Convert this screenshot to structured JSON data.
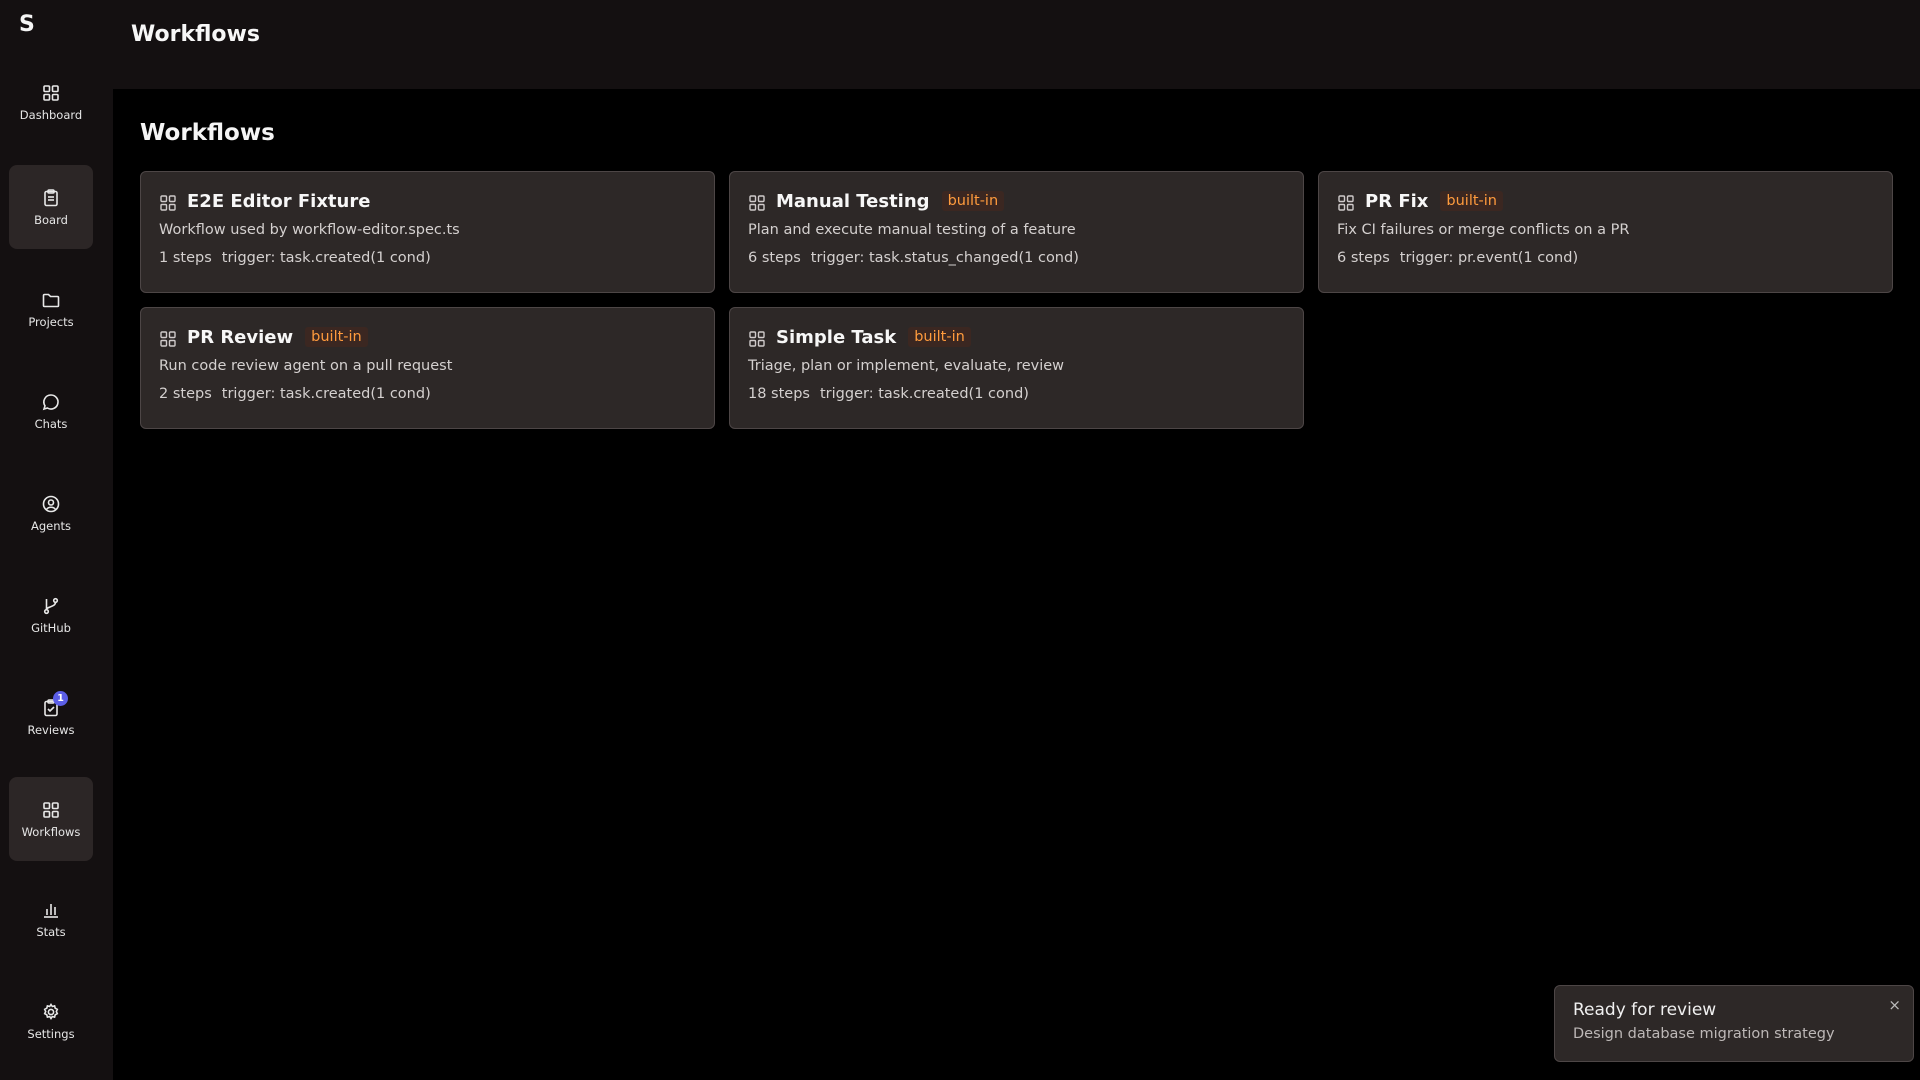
{
  "app": {
    "logo": "S"
  },
  "sidebar": {
    "items": [
      {
        "label": "Dashboard",
        "icon": "dashboard-grid-icon"
      },
      {
        "label": "Board",
        "icon": "clipboard-icon"
      },
      {
        "label": "Projects",
        "icon": "folder-icon"
      },
      {
        "label": "Chats",
        "icon": "chat-bubble-icon"
      },
      {
        "label": "Agents",
        "icon": "user-circle-icon"
      },
      {
        "label": "GitHub",
        "icon": "git-branch-icon"
      },
      {
        "label": "Reviews",
        "icon": "clipboard-check-icon",
        "badge": "1"
      },
      {
        "label": "Workflows",
        "icon": "workflow-grid-icon"
      },
      {
        "label": "Stats",
        "icon": "bar-chart-icon"
      },
      {
        "label": "Settings",
        "icon": "gear-icon"
      }
    ]
  },
  "header": {
    "title": "Workflows"
  },
  "main": {
    "heading": "Workflows",
    "builtin_label": "built-in",
    "cards": [
      {
        "title": "E2E Editor Fixture",
        "builtin": "",
        "description": "Workflow used by workflow-editor.spec.ts",
        "steps": "1 steps",
        "trigger": "trigger: task.created(1 cond)"
      },
      {
        "title": "Manual Testing",
        "builtin": "built-in",
        "description": "Plan and execute manual testing of a feature",
        "steps": "6 steps",
        "trigger": "trigger: task.status_changed(1 cond)"
      },
      {
        "title": "PR Fix",
        "builtin": "built-in",
        "description": "Fix CI failures or merge conflicts on a PR",
        "steps": "6 steps",
        "trigger": "trigger: pr.event(1 cond)"
      },
      {
        "title": "PR Review",
        "builtin": "built-in",
        "description": "Run code review agent on a pull request",
        "steps": "2 steps",
        "trigger": "trigger: task.created(1 cond)"
      },
      {
        "title": "Simple Task",
        "builtin": "built-in",
        "description": "Triage, plan or implement, evaluate, review",
        "steps": "18 steps",
        "trigger": "trigger: task.created(1 cond)"
      }
    ]
  },
  "toast": {
    "title": "Ready for review",
    "description": "Design database migration strategy",
    "close": "×"
  },
  "colors": {
    "accent_builtin": "#ff9b3d",
    "badge": "#5b5ee6",
    "card_bg": "#2d2827",
    "sidebar_bg": "#141011"
  }
}
